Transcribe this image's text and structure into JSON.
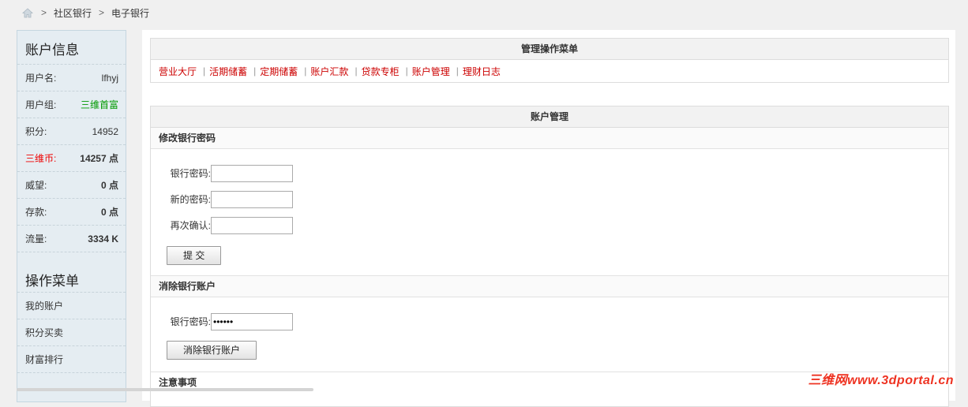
{
  "breadcrumb": {
    "items": [
      "社区银行",
      "电子银行"
    ],
    "sep": ">"
  },
  "sidebar": {
    "title": "账户信息",
    "rows": [
      {
        "label": "用户名:",
        "value": "lfhyj"
      },
      {
        "label": "用户组:",
        "value": "三维首富"
      },
      {
        "label": "积分:",
        "value": "14952"
      },
      {
        "label": "三维币:",
        "value": "14257 点"
      },
      {
        "label": "威望:",
        "value": "0 点"
      },
      {
        "label": "存款:",
        "value": "0 点"
      },
      {
        "label": "流量:",
        "value": "3334 K"
      }
    ],
    "menu_title": "操作菜单",
    "menu": [
      "我的账户",
      "积分买卖",
      "财富排行"
    ]
  },
  "ops_menu": {
    "title": "管理操作菜单",
    "links": [
      "营业大厅",
      "活期储蓄",
      "定期储蓄",
      "账户汇款",
      "贷款专柜",
      "账户管理",
      "理财日志"
    ]
  },
  "account": {
    "title": "账户管理",
    "change_pwd": {
      "title": "修改银行密码",
      "bank_pwd_label": "银行密码:",
      "new_pwd_label": "新的密码:",
      "confirm_label": "再次确认:",
      "submit": "提 交"
    },
    "delete": {
      "title": "消除银行账户",
      "bank_pwd_label": "银行密码:",
      "bank_pwd_value": "******",
      "button": "消除银行账户"
    },
    "notes_title": "注意事项"
  },
  "watermark": "三维网www.3dportal.cn"
}
